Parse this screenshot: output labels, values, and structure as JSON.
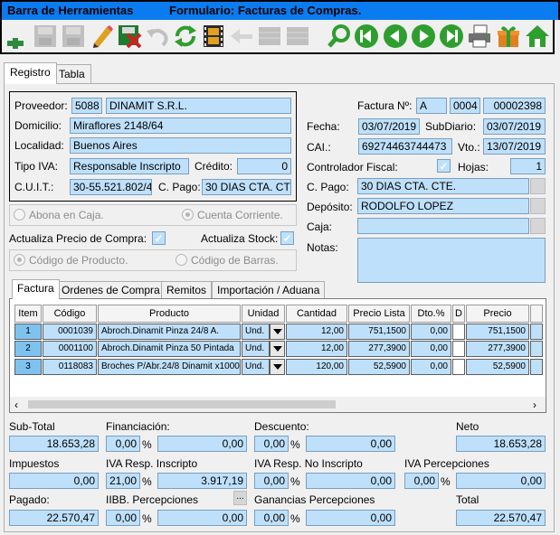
{
  "title": {
    "toolbar": "Barra de Herramientas",
    "form": "Formulario: Facturas de Compras."
  },
  "toolbar_buttons": [
    {
      "name": "add-icon",
      "color": "#2e8b3e"
    },
    {
      "name": "save-icon",
      "color": "#9a9a9a"
    },
    {
      "name": "save-as-icon",
      "color": "#9a9a9a"
    },
    {
      "name": "edit-icon",
      "color": "#e06010"
    },
    {
      "name": "delete-icon",
      "color": "#c02020"
    },
    {
      "name": "undo-icon",
      "color": "#9a9a9a"
    },
    {
      "name": "refresh-icon",
      "color": "#2e9e2e"
    },
    {
      "name": "film-icon",
      "color": "#e0a020"
    },
    {
      "name": "return-icon",
      "color": "#9a9a9a"
    },
    {
      "name": "grid-icon",
      "color": "#9a9a9a"
    },
    {
      "name": "grid2-icon",
      "color": "#9a9a9a"
    },
    {
      "name": "search-icon",
      "color": "#2e9e2e"
    },
    {
      "name": "first-icon",
      "color": "#2e9e2e"
    },
    {
      "name": "prev-icon",
      "color": "#2e9e2e"
    },
    {
      "name": "next-icon",
      "color": "#2e9e2e"
    },
    {
      "name": "last-icon",
      "color": "#2e9e2e"
    },
    {
      "name": "print-icon",
      "color": "#606060"
    },
    {
      "name": "gift-icon",
      "color": "#d08020"
    },
    {
      "name": "home-icon",
      "color": "#2e9e2e"
    }
  ],
  "tabs": [
    "Registro",
    "Tabla"
  ],
  "proveedor": {
    "label": "Proveedor:",
    "code": "5088",
    "name": "DINAMIT S.R.L."
  },
  "domicilio": {
    "label": "Domicilio:",
    "value": "Miraflores 2148/64"
  },
  "localidad": {
    "label": "Localidad:",
    "value": "Buenos Aires"
  },
  "tipo_iva": {
    "label": "Tipo IVA:",
    "value": "Responsable Inscripto",
    "credito_label": "Crédito:",
    "credito": "0"
  },
  "cuit": {
    "label": "C.U.I.T.:",
    "value": "30-55.521.802/4",
    "cpago_label": "C. Pago:",
    "cpago": "30 DIAS CTA. CT"
  },
  "abona_caja": "Abona en Caja.",
  "cuenta_corriente": "Cuenta Corriente.",
  "actualiza_precio": "Actualiza Precio de Compra:",
  "actualiza_stock": "Actualiza Stock:",
  "codigo_producto": "Código de Producto.",
  "codigo_barras": "Código de Barras.",
  "factura": {
    "label": "Factura Nº:",
    "letra": "A",
    "pv": "0004",
    "numero": "00002398"
  },
  "fecha": {
    "label": "Fecha:",
    "value": "03/07/2019",
    "subdiario_label": "SubDiario:",
    "subdiario": "03/07/2019"
  },
  "cai": {
    "label": "CAI.:",
    "value": "69274463744473",
    "vto_label": "Vto.:",
    "vto": "13/07/2019"
  },
  "controlador": {
    "label": "Controlador Fiscal:",
    "hojas_label": "Hojas:",
    "hojas": "1"
  },
  "cpago_r": {
    "label": "C. Pago:",
    "value": "30 DIAS CTA. CTE."
  },
  "deposito": {
    "label": "Depósito:",
    "value": "RODOLFO LOPEZ"
  },
  "caja": {
    "label": "Caja:",
    "value": ""
  },
  "notas": {
    "label": "Notas:",
    "value": ""
  },
  "subtabs": [
    "Factura",
    "Ordenes de Compra",
    "Remitos",
    "Importación / Aduana"
  ],
  "grid": {
    "headers": [
      "Item",
      "Código",
      "Producto",
      "Unidad",
      "Cantidad",
      "Precio Lista",
      "Dto.%",
      "D",
      "Precio"
    ],
    "rows": [
      {
        "item": "1",
        "codigo": "0001039",
        "producto": "Abroch.Dinamit Pinza 24/8 A.",
        "unidad": "Und.",
        "cantidad": "12,00",
        "lista": "751,1500",
        "dto": "0,00",
        "precio": "751,1500"
      },
      {
        "item": "2",
        "codigo": "0001100",
        "producto": "Abroch.Dinamit Pinza 50 Pintada",
        "unidad": "Und.",
        "cantidad": "12,00",
        "lista": "277,3900",
        "dto": "0,00",
        "precio": "277,3900"
      },
      {
        "item": "3",
        "codigo": "0118083",
        "producto": "Broches P/Abr.24/8 Dinamit x1000",
        "unidad": "Und.",
        "cantidad": "120,00",
        "lista": "52,5900",
        "dto": "0,00",
        "precio": "52,5900"
      }
    ]
  },
  "totals": {
    "subtotal_label": "Sub-Total",
    "subtotal": "18.653,28",
    "financiacion_label": "Financiación:",
    "financiacion_pct": "0,00",
    "financiacion": "0,00",
    "descuento_label": "Descuento:",
    "descuento_pct": "0,00",
    "descuento": "0,00",
    "neto_label": "Neto",
    "neto": "18.653,28",
    "impuestos_label": "Impuestos",
    "impuestos": "0,00",
    "iva_ri_label": "IVA Resp. Inscripto",
    "iva_ri_pct": "21,00",
    "iva_ri": "3.917,19",
    "iva_rni_label": "IVA Resp. No Inscripto",
    "iva_rni_pct": "0,00",
    "iva_rni": "0,00",
    "iva_perc_label": "IVA Percepciones",
    "iva_perc_pct": "0,00",
    "iva_perc": "0,00",
    "pagado_label": "Pagado:",
    "pagado": "22.570,47",
    "iibb_label": "IIBB. Percepciones",
    "iibb_pct": "0,00",
    "iibb": "0,00",
    "ganancias_label": "Ganancias Percepciones",
    "ganancias_pct": "0,00",
    "ganancias": "0,00",
    "total_label": "Total",
    "total": "22.570,47",
    "pct": "%",
    "dots": "..."
  }
}
